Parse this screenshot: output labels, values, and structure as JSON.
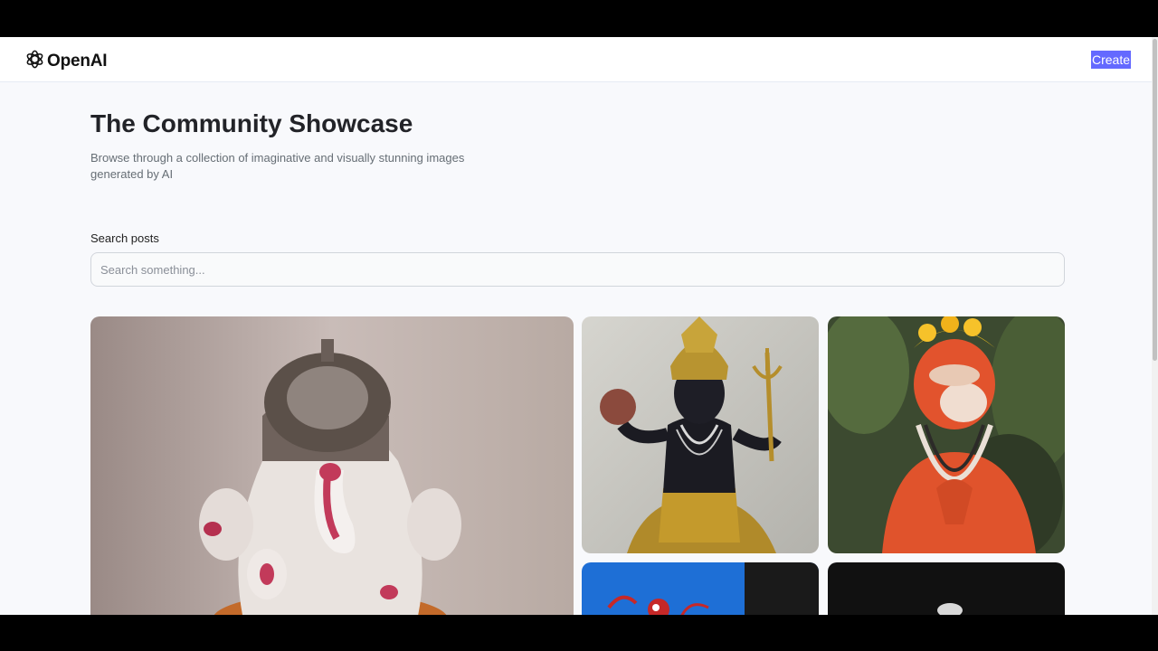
{
  "header": {
    "brand": "OpenAI",
    "create_label": "Create"
  },
  "hero": {
    "title": "The Community Showcase",
    "subtitle": "Browse through a collection of imaginative and visually stunning images generated by AI"
  },
  "search": {
    "label": "Search posts",
    "placeholder": "Search something...",
    "value": ""
  },
  "gallery": {
    "items": [
      {
        "subject": "white ganesha idol"
      },
      {
        "subject": "black shiva idol with trident"
      },
      {
        "subject": "orange hanuman idol"
      },
      {
        "subject": "spider-man on blue sky"
      },
      {
        "subject": "dark image"
      }
    ]
  },
  "colors": {
    "accent": "#6469ff",
    "page_bg": "#f8f9fc",
    "title": "#222328",
    "subtitle": "#666e75"
  }
}
